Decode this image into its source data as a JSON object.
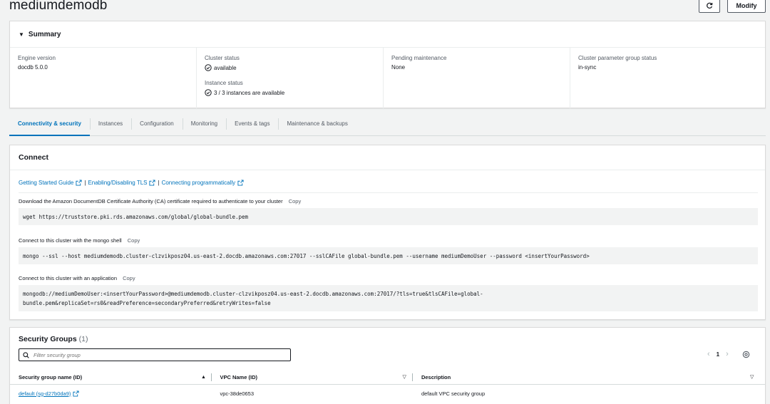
{
  "header": {
    "title": "mediumdemodb",
    "modify_label": "Modify"
  },
  "summary": {
    "title": "Summary",
    "engine_version_label": "Engine version",
    "engine_version_value": "docdb 5.0.0",
    "cluster_status_label": "Cluster status",
    "cluster_status_value": "available",
    "instance_status_label": "Instance status",
    "instance_status_value": "3 / 3 instances are available",
    "pending_maintenance_label": "Pending maintenance",
    "pending_maintenance_value": "None",
    "param_group_status_label": "Cluster parameter group status",
    "param_group_status_value": "in-sync"
  },
  "tabs": [
    {
      "label": "Connectivity & security"
    },
    {
      "label": "Instances"
    },
    {
      "label": "Configuration"
    },
    {
      "label": "Monitoring"
    },
    {
      "label": "Events & tags"
    },
    {
      "label": "Maintenance & backups"
    }
  ],
  "connect": {
    "title": "Connect",
    "links": [
      "Getting Started Guide",
      "Enabling/Disabling TLS",
      "Connecting programmatically"
    ],
    "separator": "|",
    "copy_label": "Copy",
    "ca_label": "Download the Amazon DocumentDB Certificate Authority (CA) certificate required to authenticate to your cluster",
    "ca_command": "wget https://truststore.pki.rds.amazonaws.com/global/global-bundle.pem",
    "shell_label": "Connect to this cluster with the mongo shell",
    "shell_command": "mongo --ssl --host mediumdemodb.cluster-clzvikposz04.us-east-2.docdb.amazonaws.com:27017 --sslCAFile global-bundle.pem --username mediumDemoUser --password <insertYourPassword>",
    "app_label": "Connect to this cluster with an application",
    "app_command_line1": "mongodb://mediumDemoUser:<insertYourPassword>@mediumdemodb.cluster-clzvikposz04.us-east-2.docdb.amazonaws.com:27017/?tls=true&tlsCAFile=global-",
    "app_command_line2": "bundle.pem&replicaSet=rs0&readPreference=secondaryPreferred&retryWrites=false"
  },
  "security_groups": {
    "title": "Security Groups",
    "count": "(1)",
    "filter_placeholder": "Filter security group",
    "page": "1",
    "columns": [
      "Security group name (ID)",
      "VPC Name (ID)",
      "Description"
    ],
    "rows": [
      {
        "name": "default (sg-d27b0da9)",
        "vpc": "vpc-38de0653",
        "description": "default VPC security group"
      }
    ]
  },
  "colors": {
    "accent": "#0073bb",
    "success": "#16191f"
  },
  "icons": [
    "refresh-icon",
    "check-circle-icon",
    "external-link-icon",
    "search-icon",
    "chevron-left-icon",
    "chevron-right-icon",
    "gear-icon",
    "caret-down-icon"
  ]
}
